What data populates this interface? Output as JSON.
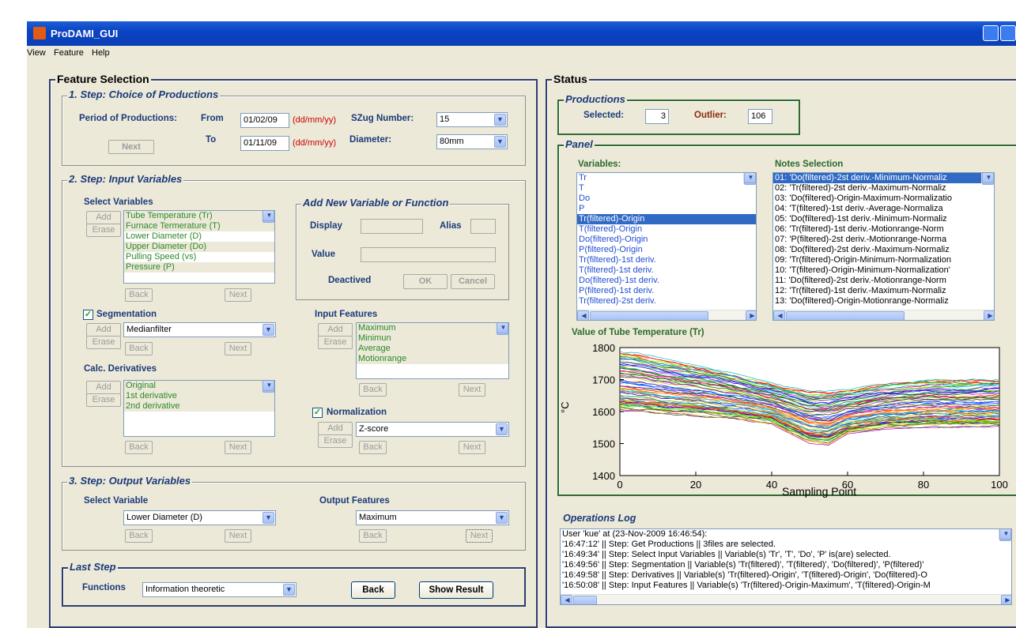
{
  "window": {
    "title": "ProDAMI_GUI"
  },
  "menu": [
    "View",
    "Feature",
    "Help"
  ],
  "left": {
    "title": "Feature Selection",
    "step1": {
      "title": "1. Step: Choice of Productions",
      "period_label": "Period of Productions:",
      "from_label": "From",
      "from_value": "01/02/09",
      "from_hint": "(dd/mm/yy)",
      "to_label": "To",
      "to_value": "01/11/09",
      "to_hint": "(dd/mm/yy)",
      "szug_label": "SZug Number:",
      "szug_value": "15",
      "diameter_label": "Diameter:",
      "diameter_value": "80mm",
      "next": "Next"
    },
    "step2": {
      "title": "2. Step: Input Variables",
      "select_variables": "Select Variables",
      "variables": [
        "Tube Temperature (Tr)",
        "Furnace Termerature (T)",
        "Lower Diameter (D)",
        "Upper Diameter (Do)",
        "Pulling Speed (vs)",
        "Pressure (P)"
      ],
      "add": "Add",
      "erase": "Erase",
      "back": "Back",
      "next": "Next",
      "newvar": {
        "title": "Add New Variable or Function",
        "display": "Display",
        "alias": "Alias",
        "value": "Value",
        "deactived": "Deactived",
        "ok": "OK",
        "cancel": "Cancel"
      },
      "segmentation": "Segmentation",
      "segmentation_value": "Medianfilter",
      "calc_derivatives": "Calc. Derivatives",
      "derivatives": [
        "Original",
        "1st derivative",
        "2nd derivative"
      ],
      "input_features": "Input Features",
      "features": [
        "Maximum",
        "Minimun",
        "Average",
        "Motionrange"
      ],
      "normalization": "Normalization",
      "normalization_value": "Z-score"
    },
    "step3": {
      "title": "3. Step: Output Variables",
      "select_variable": "Select Variable",
      "variable_value": "Lower Diameter (D)",
      "output_features": "Output Features",
      "feature_value": "Maximum",
      "back": "Back",
      "next": "Next"
    },
    "last": {
      "title": "Last Step",
      "functions_label": "Functions",
      "functions_value": "Information theoretic",
      "back": "Back",
      "show_result": "Show Result"
    }
  },
  "right": {
    "title": "Status",
    "productions": {
      "title": "Productions",
      "selected_label": "Selected:",
      "selected_value": "3",
      "outlier_label": "Outlier:",
      "outlier_value": "106"
    },
    "panel": {
      "title": "Panel",
      "variables_label": "Variables:",
      "variables": [
        "Tr",
        "T",
        "Do",
        "P",
        "Tr(filtered)-Origin",
        "T(filtered)-Origin",
        "Do(filtered)-Origin",
        "P(filtered)-Origin",
        "Tr(filtered)-1st deriv.",
        "T(filtered)-1st deriv.",
        "Do(filtered)-1st deriv.",
        "P(filtered)-1st deriv.",
        "Tr(filtered)-2st deriv."
      ],
      "notes_label": "Notes Selection",
      "notes": [
        "01: 'Do(filtered)-2st deriv.-Minimum-Normaliz",
        "02: 'Tr(filtered)-2st deriv.-Maximum-Normaliz",
        "03: 'Do(filtered)-Origin-Maximum-Normalizatio",
        "04: 'T(filtered)-1st deriv.-Average-Normaliza",
        "05: 'Do(filtered)-1st deriv.-Minimum-Normaliz",
        "06: 'Tr(filtered)-1st deriv.-Motionrange-Norm",
        "07: 'P(filtered)-2st deriv.-Motionrange-Norma",
        "08: 'Do(filtered)-2st deriv.-Maximum-Normaliz",
        "09: 'Tr(filtered)-Origin-Minimum-Normalization",
        "10: 'T(filtered)-Origin-Minimum-Normalization'",
        "11: 'Do(filtered)-2st deriv.-Motionrange-Norm",
        "12: 'Tr(filtered)-1st deriv.-Maximum-Normaliz",
        "13: 'Do(filtered)-Origin-Motionrange-Normaliz"
      ]
    },
    "log": {
      "title": "Operations Log",
      "lines": [
        "User 'kue' at (23-Nov-2009 16:46:54):",
        "'16:47:12' || Step: Get Productions || 3files are selected.",
        "'16:49:34' || Step: Select Input Variables || Variable(s) 'Tr', 'T', 'Do', 'P' is(are) selected.",
        "'16:49:56' || Step: Segmentation || Variable(s) 'Tr(filtered)', 'T(filtered)', 'Do(filtered)', 'P(filtered)'",
        "'16:49:58' || Step: Derivatives || Variable(s) 'Tr(filtered)-Origin', 'T(filtered)-Origin', 'Do(filtered)-O",
        "'16:50:08' || Step: Input Features || Variable(s) 'Tr(filtered)-Origin-Maximum', 'T(filtered)-Origin-M"
      ]
    }
  },
  "chart_data": {
    "type": "line",
    "title": "Value of Tube Temperature (Tr)",
    "xlabel": "Sampling Point",
    "ylabel": "°C",
    "xlim": [
      0,
      100
    ],
    "ylim": [
      1400,
      1800
    ],
    "xticks": [
      "0",
      "20",
      "40",
      "60",
      "80",
      "100"
    ],
    "yticks": [
      "1400",
      "1500",
      "1600",
      "1700",
      "1800"
    ],
    "envelope": {
      "x": [
        0,
        5,
        10,
        20,
        30,
        40,
        50,
        55,
        60,
        70,
        80,
        90,
        100
      ],
      "upper": [
        1790,
        1785,
        1770,
        1745,
        1720,
        1690,
        1665,
        1665,
        1670,
        1690,
        1700,
        1700,
        1705
      ],
      "lower": [
        1600,
        1595,
        1590,
        1585,
        1575,
        1560,
        1500,
        1495,
        1530,
        1545,
        1550,
        1550,
        1550
      ]
    }
  }
}
